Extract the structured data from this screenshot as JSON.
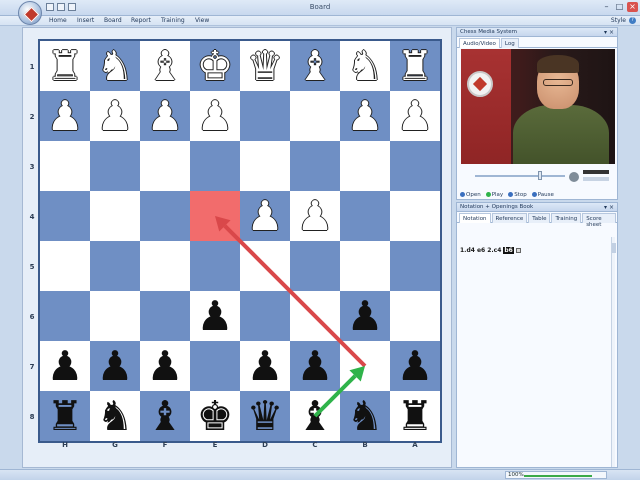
{
  "window": {
    "title": "Board",
    "style_label": "Style",
    "help": "?"
  },
  "menu": [
    "Home",
    "Insert",
    "Board",
    "Report",
    "Training",
    "View"
  ],
  "board": {
    "ranks": [
      "1",
      "2",
      "3",
      "4",
      "5",
      "6",
      "7",
      "8"
    ],
    "files": [
      "H",
      "G",
      "F",
      "E",
      "D",
      "C",
      "B",
      "A"
    ],
    "rows": [
      [
        "♜w",
        "♞w",
        "♝w",
        "♚w",
        "♛w",
        "♝w",
        "♞w",
        "♜w"
      ],
      [
        "♟w",
        "♟w",
        "♟w",
        "♟w",
        "",
        "",
        "♟w",
        "♟w"
      ],
      [
        "",
        "",
        "",
        "",
        "",
        "",
        "",
        ""
      ],
      [
        "",
        "",
        "",
        "",
        "♟w",
        "♟w",
        "",
        ""
      ],
      [
        "",
        "",
        "",
        "",
        "",
        "",
        "",
        ""
      ],
      [
        "",
        "",
        "",
        "♟b",
        "",
        "",
        "♟b",
        ""
      ],
      [
        "♟b",
        "♟b",
        "♟b",
        "",
        "♟b",
        "♟b",
        "",
        "♟b"
      ],
      [
        "♜b",
        "♞b",
        "♝b",
        "♚b",
        "♛b",
        "♝b",
        "♞b",
        "♜b"
      ]
    ],
    "highlight": {
      "row": 3,
      "col": 3,
      "color": "#f26c6c"
    },
    "arrows": [
      {
        "from": [
          6,
          6
        ],
        "to": [
          3,
          3
        ],
        "color": "#d9484a"
      },
      {
        "from": [
          7,
          5
        ],
        "to": [
          6,
          6
        ],
        "color": "#2fb34a"
      }
    ]
  },
  "media_panel": {
    "title": "Chess Media System",
    "tabs": [
      {
        "label": "Audio/Video",
        "active": true
      },
      {
        "label": "Log",
        "active": false
      }
    ],
    "buttons": [
      {
        "label": "Open",
        "color": "#3a6fbf"
      },
      {
        "label": "Play",
        "color": "#2fb34a"
      },
      {
        "label": "Stop",
        "color": "#3a6fbf"
      },
      {
        "label": "Pause",
        "color": "#3a6fbf"
      }
    ],
    "seek": 0.7
  },
  "notation_panel": {
    "title": "Notation + Openings Book",
    "tabs": [
      {
        "label": "Notation",
        "active": true
      },
      {
        "label": "Reference",
        "active": false
      },
      {
        "label": "Table",
        "active": false
      },
      {
        "label": "Training",
        "active": false
      },
      {
        "label": "Score sheet",
        "active": false
      }
    ],
    "moves": [
      "1.d4",
      "e6",
      "2.c4"
    ],
    "current_move": "b6"
  },
  "status": {
    "zoom_label": "100%",
    "progress": 0.85
  },
  "colors": {
    "light_square": "#ffffff",
    "dark_square": "#6f8fc4",
    "accent": "#3a5a8c"
  }
}
